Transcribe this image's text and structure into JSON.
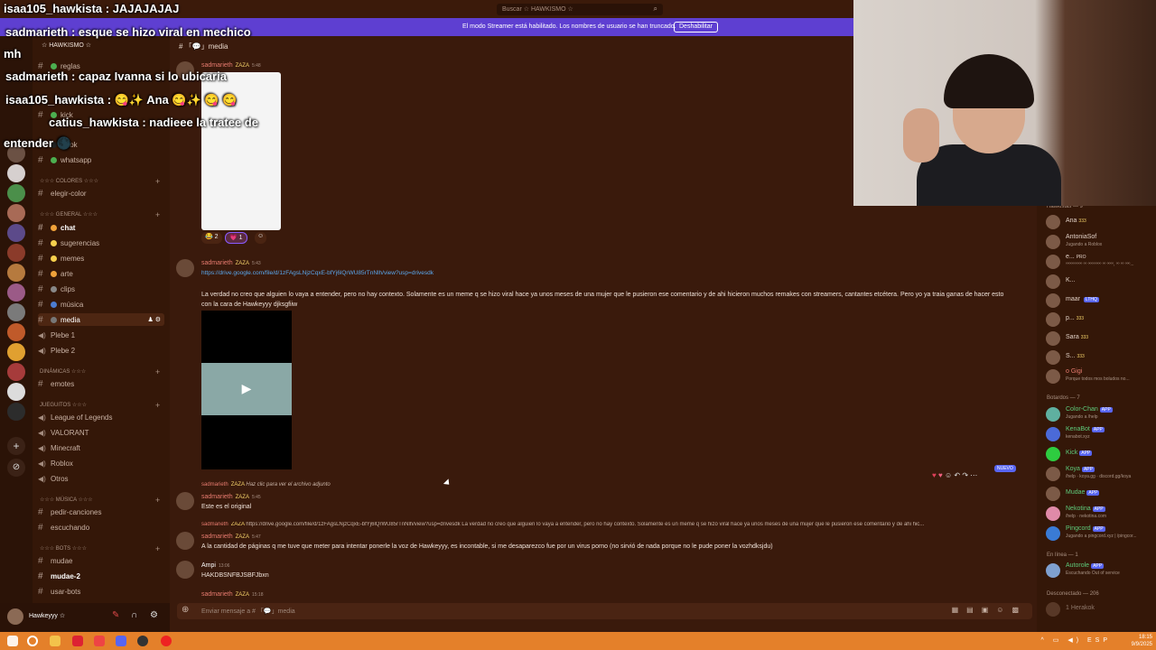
{
  "search": {
    "placeholder": "Buscar ☆ HAWKISMO ☆"
  },
  "banner": {
    "text": "El modo Streamer está habilitado. Los nombres de usuario se han truncado.",
    "button": "Deshabilitar"
  },
  "server": {
    "name": "☆ HAWKISMO ☆"
  },
  "channel_header": {
    "name": "media"
  },
  "sidebar": {
    "channels_top": [
      {
        "label": "reglas"
      },
      {
        "label": "kick"
      },
      {
        "label": "tiktok"
      },
      {
        "label": "whatsapp"
      }
    ],
    "cat_colores": "☆☆☆ COLORES ☆☆☆",
    "colores": [
      {
        "label": "elegir-color"
      }
    ],
    "cat_general": "☆☆☆ GENERAL ☆☆☆",
    "general": [
      {
        "label": "chat"
      },
      {
        "label": "sugerencias"
      },
      {
        "label": "memes"
      },
      {
        "label": "arte"
      },
      {
        "label": "clips"
      },
      {
        "label": "música"
      },
      {
        "label": "media"
      },
      {
        "label": "Plebe 1"
      },
      {
        "label": "Plebe 2"
      }
    ],
    "cat_dinamicas": "DINÁMICAS ☆☆☆",
    "dinamicas": [
      {
        "label": "emotes"
      }
    ],
    "cat_jueguitos": "JUEGUITOS ☆☆☆",
    "jueguitos": [
      {
        "label": "League of Legends"
      },
      {
        "label": "VALORANT"
      },
      {
        "label": "Minecraft"
      },
      {
        "label": "Roblox"
      },
      {
        "label": "Otros"
      }
    ],
    "cat_musica": "☆☆☆ MÚSICA ☆☆☆",
    "musica": [
      {
        "label": "pedir-canciones"
      },
      {
        "label": "escuchando"
      }
    ],
    "cat_bots": "☆☆☆ BOTS ☆☆☆",
    "bots": [
      {
        "label": "mudae"
      },
      {
        "label": "mudae-2"
      },
      {
        "label": "usar-bots"
      }
    ]
  },
  "user_bar": {
    "name": "Hawkeyyy ☆"
  },
  "messages": [
    {
      "user": "sadmarieth",
      "tag": "ZAZA",
      "time": "5:48"
    },
    {
      "user": "sadmarieth",
      "tag": "ZAZA",
      "time": "5:43",
      "link": "https://drive.google.com/file/d/1zFAgsLNjzCqxE-bfYj6lQrWU85rTnNlh/view?usp=drivesdk",
      "text": "La verdad no creo que alguien lo vaya a entender, pero no hay contexto. Solamente es un meme q se hizo viral hace ya unos meses de una mujer que le pusieron ese comentario y de ahi hicieron muchos remakes con streamers, cantantes etcétera. Pero yo ya traia ganas de hacer esto con la cara de Hawkeyyy djksgfiiw"
    },
    {
      "user": "sadmarieth",
      "tag": "ZAZA",
      "text": "Haz clic para ver el archivo adjunto"
    },
    {
      "user": "sadmarieth",
      "tag": "ZAZA",
      "time": "5:45",
      "text": "Este es el original"
    },
    {
      "user": "sadmarieth",
      "tag": "ZAZA",
      "text": "https://drive.google.com/file/d/1zFAgsLNjzCqxE-bfYj6lQrWU85rTnNlh/view?usp=drivesdk La verdad no creo que alguien lo vaya a entender, pero no hay contexto. Solamente es un meme q se hizo viral hace ya unos meses de una mujer que le pusieron ese comentario y de ahi hic..."
    },
    {
      "user": "sadmarieth",
      "tag": "ZAZA",
      "time": "5:47",
      "text": "A la cantidad de páginas q me tuve que meter para intentar ponerle la voz de Hawkeyyy, es incontable, si me desaparezco fue por un virus porno (no sirvió de nada porque no le pude poner la vozhdksjdu)"
    },
    {
      "user": "Ampi",
      "tag": "",
      "time": "13:06",
      "text": "HAKDBSNFBJSBFJbxn"
    },
    {
      "user": "sadmarieth",
      "tag": "ZAZA",
      "time": "15:18"
    }
  ],
  "reactions": [
    {
      "emoji": "😂",
      "count": "2"
    },
    {
      "emoji": "💗",
      "count": "1"
    }
  ],
  "nuevo": "NUEVO",
  "composer": {
    "placeholder": "Enviar mensaje a # 「💬」media"
  },
  "members": {
    "group_hawkistas": "Hawkistas — 9",
    "hawkistas": [
      {
        "name": "Ana",
        "badge": "333"
      },
      {
        "name": "AntoniaSof",
        "status": "Jugando a Roblox"
      },
      {
        "name": "e...",
        "badge": "PRO",
        "status": "ºººººººººº ºº ºººººººº ºº ºººº, ºº ºº ººº..."
      },
      {
        "name": "K..."
      },
      {
        "name": "maar",
        "badge": "LTHQ"
      },
      {
        "name": "p...",
        "badge": "333"
      },
      {
        "name": "Sara",
        "badge": "333"
      },
      {
        "name": "S...",
        "badge": "333"
      },
      {
        "name": "o Gigi",
        "status": "Porque todos mos boludos no..."
      }
    ],
    "group_bots": "Botardos — 7",
    "bots": [
      {
        "name": "Color-Chan",
        "status": "Jugando a /help"
      },
      {
        "name": "KenaBot",
        "status": "kenabot.xyz"
      },
      {
        "name": "Kick"
      },
      {
        "name": "Koya",
        "status": "/help · koya.gg · discord.gg/koya"
      },
      {
        "name": "Mudae"
      },
      {
        "name": "Nekotina",
        "status": "/help · nekotina.com"
      },
      {
        "name": "Pingcord",
        "status": "Jugando a pingcord.xyz | /pingcor..."
      }
    ],
    "app_label": "APP",
    "group_online": "En línea — 1",
    "online": [
      {
        "name": "Autorole",
        "status": "Escuchando Out of service"
      }
    ],
    "group_offline": "Desconectado — 206",
    "offline": [
      {
        "name": "1 Herakok"
      }
    ]
  },
  "overlay_chat": [
    "isaa105_hawkista : JAJAJAJAJ",
    "sadmarieth : esque se hizo viral en mechico",
    "mh",
    "sadmarieth : capaz Ivanna si lo ubicaria",
    "isaa105_hawkista : 😋✨ Ana 😋✨ 😋 😋",
    "catius_hawkista : nadieee la tratee de",
    "entender 🌑"
  ],
  "taskbar": {
    "lang": "ESP",
    "time": "18:15",
    "date": "9/9/2025"
  },
  "colors": {
    "accent": "#5865f2",
    "username": "#e77b6f",
    "link": "#5aa8ee",
    "bg": "#3a1a0c"
  }
}
